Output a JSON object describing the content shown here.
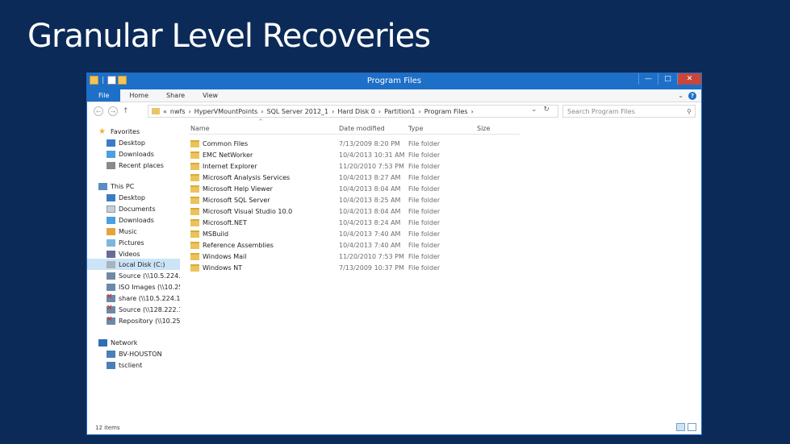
{
  "slide": {
    "title": "Granular Level Recoveries"
  },
  "window": {
    "title": "Program Files",
    "qat_sep": "|",
    "controls": {
      "minimize": "—",
      "maximize": "□",
      "close": "✕"
    }
  },
  "ribbon": {
    "tabs": [
      "File",
      "Home",
      "Share",
      "View"
    ],
    "expand_chevron": "⌄",
    "help": "?"
  },
  "nav": {
    "back": "←",
    "forward": "→",
    "up": "↑",
    "address_segments": [
      "«",
      "nwfs",
      "›",
      "HyperVMountPoints",
      "›",
      "SQL Server 2012_1",
      "›",
      "Hard Disk 0",
      "›",
      "Partition1",
      "›",
      "Program Files",
      "›"
    ],
    "dropdown": "⌄",
    "refresh": "↻",
    "search_placeholder": "Search Program Files",
    "search_icon": "⚲"
  },
  "navpane": {
    "items": [
      {
        "label": "Favorites",
        "icon": "star-icon"
      },
      {
        "label": "Desktop",
        "icon": "desktop-icon"
      },
      {
        "label": "Downloads",
        "icon": "downloads-icon"
      },
      {
        "label": "Recent places",
        "icon": "recent-places-icon"
      },
      {
        "label": "This PC",
        "icon": "this-pc-icon"
      },
      {
        "label": "Desktop",
        "icon": "desktop-icon"
      },
      {
        "label": "Documents",
        "icon": "documents-icon"
      },
      {
        "label": "Downloads",
        "icon": "downloads-icon"
      },
      {
        "label": "Music",
        "icon": "music-icon"
      },
      {
        "label": "Pictures",
        "icon": "pictures-icon"
      },
      {
        "label": "Videos",
        "icon": "videos-icon"
      },
      {
        "label": "Local Disk (C:)",
        "icon": "local-disk-icon",
        "selected": true
      },
      {
        "label": "Source (\\\\10.5.224.2",
        "icon": "network-drive-icon"
      },
      {
        "label": "ISO Images (\\\\10.25.",
        "icon": "network-drive-icon"
      },
      {
        "label": "share (\\\\10.5.224.17)",
        "icon": "disconnected-drive-icon"
      },
      {
        "label": "Source (\\\\128.222.1",
        "icon": "disconnected-drive-icon"
      },
      {
        "label": "Repository (\\\\10.25.0",
        "icon": "disconnected-drive-icon"
      },
      {
        "label": "Network",
        "icon": "network-icon"
      },
      {
        "label": "BV-HOUSTON",
        "icon": "computer-icon"
      },
      {
        "label": "tsclient",
        "icon": "computer-icon"
      }
    ]
  },
  "columns": [
    "Name",
    "Date modified",
    "Type",
    "Size"
  ],
  "sort_indicator": "^",
  "files": [
    {
      "name": "Common Files",
      "date": "7/13/2009 8:20 PM",
      "type": "File folder"
    },
    {
      "name": "EMC NetWorker",
      "date": "10/4/2013 10:31 AM",
      "type": "File folder"
    },
    {
      "name": "Internet Explorer",
      "date": "11/20/2010 7:53 PM",
      "type": "File folder"
    },
    {
      "name": "Microsoft Analysis Services",
      "date": "10/4/2013 8:27 AM",
      "type": "File folder"
    },
    {
      "name": "Microsoft Help Viewer",
      "date": "10/4/2013 8:04 AM",
      "type": "File folder"
    },
    {
      "name": "Microsoft SQL Server",
      "date": "10/4/2013 8:25 AM",
      "type": "File folder"
    },
    {
      "name": "Microsoft Visual Studio 10.0",
      "date": "10/4/2013 8:04 AM",
      "type": "File folder"
    },
    {
      "name": "Microsoft.NET",
      "date": "10/4/2013 8:24 AM",
      "type": "File folder"
    },
    {
      "name": "MSBuild",
      "date": "10/4/2013 7:40 AM",
      "type": "File folder"
    },
    {
      "name": "Reference Assemblies",
      "date": "10/4/2013 7:40 AM",
      "type": "File folder"
    },
    {
      "name": "Windows Mail",
      "date": "11/20/2010 7:53 PM",
      "type": "File folder"
    },
    {
      "name": "Windows NT",
      "date": "7/13/2009 10:37 PM",
      "type": "File folder"
    }
  ],
  "status": {
    "item_count": "12 items"
  }
}
